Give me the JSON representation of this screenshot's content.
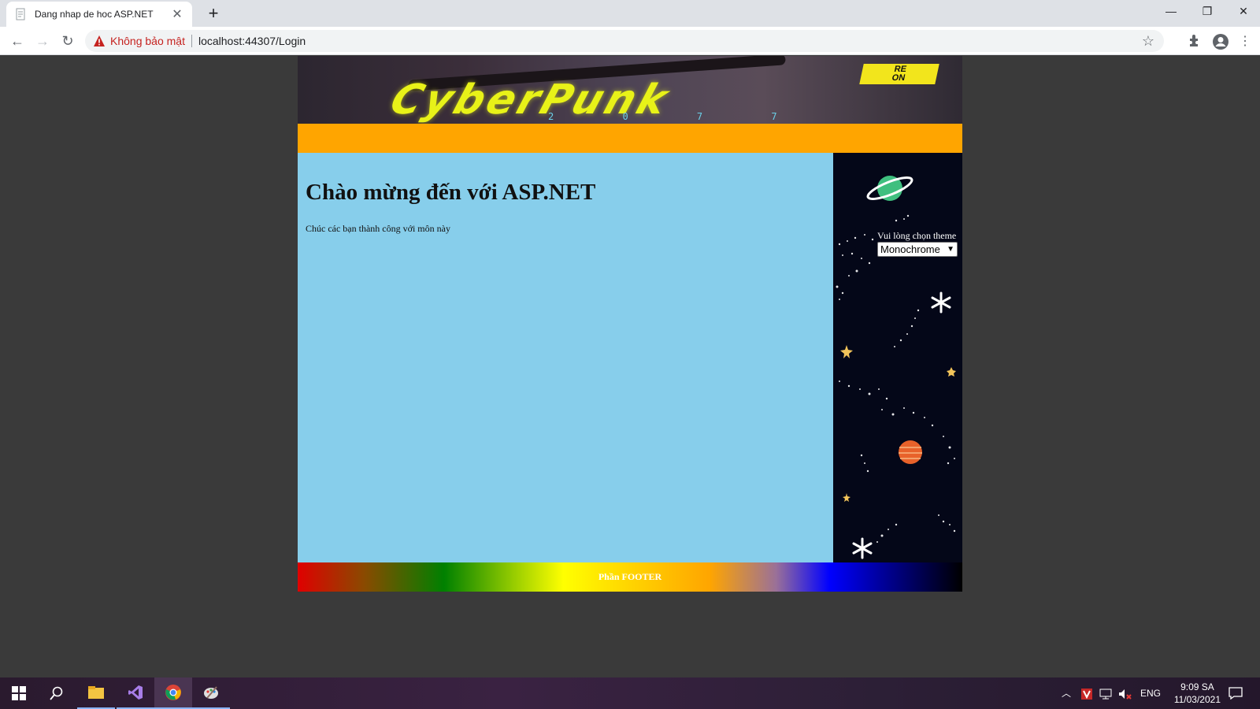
{
  "browser": {
    "tab_title": "Dang nhap de hoc ASP.NET",
    "tab_close": "✕",
    "new_tab": "+",
    "security_label": "Không bảo mật",
    "url": "localhost:44307/Login"
  },
  "page": {
    "banner": {
      "logo_text": "CyberPunk",
      "sub_text": "2 0 7 7",
      "badge_top": "RE",
      "badge_bottom": "ON"
    },
    "heading": "Chào mừng đến với ASP.NET",
    "subtext": "Chúc các bạn thành công với môn này",
    "theme_label": "Vui lòng chọn theme",
    "theme_selected": "Monochrome",
    "footer": "Phần FOOTER"
  },
  "taskbar": {
    "language": "ENG",
    "time": "9:09 SA",
    "date": "11/03/2021"
  },
  "colors": {
    "header_bar": "#ffa500",
    "main_bg": "#87ceeb",
    "sidebar_bg": "#040718",
    "page_bg": "#3a3a3a"
  }
}
